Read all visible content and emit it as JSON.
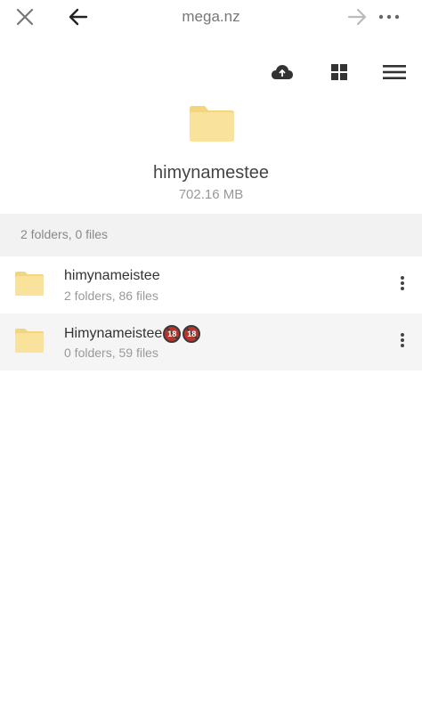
{
  "browser": {
    "url": "mega.nz",
    "icons": [
      "close-icon",
      "back-arrow-icon",
      "forward-arrow-icon",
      "more-icon"
    ]
  },
  "toolbar": {
    "icons": [
      "cloud-upload-icon",
      "grid-view-icon",
      "hamburger-menu-icon"
    ]
  },
  "folder": {
    "title": "himynamestee",
    "size": "702.16 MB",
    "icon": "folder-icon"
  },
  "summary": "2 folders, 0 files",
  "items": [
    {
      "name": "himynameistee",
      "meta": "2 folders, 86 files",
      "badges": []
    },
    {
      "name": "Himynameistee",
      "meta": "0 folders, 59 files",
      "badges": [
        "18",
        "18"
      ]
    }
  ],
  "colors": {
    "folder_fill": "#f9e29b",
    "folder_tab": "#f4d57c",
    "badge_red": "#b8352c",
    "summary_bg": "#f2f2f2"
  }
}
